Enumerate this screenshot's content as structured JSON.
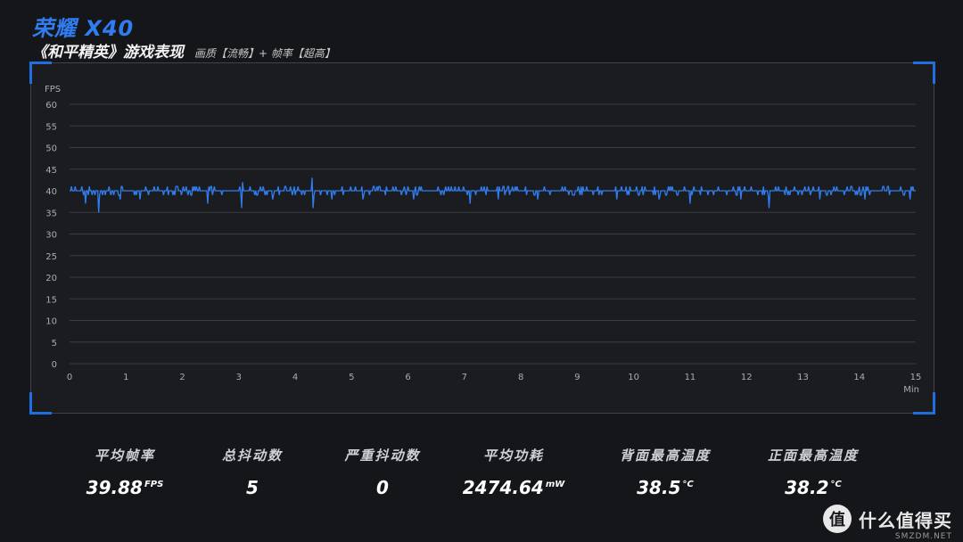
{
  "header": {
    "brand": "荣耀 X40",
    "game_title": "《和平精英》游戏表现",
    "settings": "画质【流畅】+ 帧率【超高】"
  },
  "chart_data": {
    "type": "line",
    "ylabel": "FPS",
    "xlabel": "Min",
    "ylim": [
      0,
      60
    ],
    "xlim": [
      0,
      15
    ],
    "y_ticks": [
      0,
      5,
      10,
      15,
      20,
      25,
      30,
      35,
      40,
      45,
      50,
      55,
      60
    ],
    "x_ticks": [
      0,
      1,
      2,
      3,
      4,
      5,
      6,
      7,
      8,
      9,
      10,
      11,
      12,
      13,
      14,
      15
    ],
    "grid": true,
    "line_color": "#2f7df0",
    "baseline": 40,
    "dips": [
      {
        "x": 0.28,
        "y": 37
      },
      {
        "x": 0.52,
        "y": 35
      },
      {
        "x": 0.9,
        "y": 38
      },
      {
        "x": 1.25,
        "y": 38
      },
      {
        "x": 2.45,
        "y": 37
      },
      {
        "x": 3.05,
        "y": 36
      },
      {
        "x": 3.6,
        "y": 38
      },
      {
        "x": 4.32,
        "y": 36
      },
      {
        "x": 4.65,
        "y": 38
      },
      {
        "x": 5.2,
        "y": 38
      },
      {
        "x": 6.1,
        "y": 38
      },
      {
        "x": 7.1,
        "y": 37
      },
      {
        "x": 7.6,
        "y": 38
      },
      {
        "x": 8.3,
        "y": 38
      },
      {
        "x": 9.7,
        "y": 38
      },
      {
        "x": 10.45,
        "y": 38
      },
      {
        "x": 11.0,
        "y": 37
      },
      {
        "x": 11.9,
        "y": 38
      },
      {
        "x": 12.4,
        "y": 36
      },
      {
        "x": 13.3,
        "y": 38
      },
      {
        "x": 14.1,
        "y": 38
      },
      {
        "x": 14.9,
        "y": 38
      }
    ],
    "peaks": [
      {
        "x": 3.07,
        "y": 42
      },
      {
        "x": 4.3,
        "y": 43
      },
      {
        "x": 11.2,
        "y": 41
      },
      {
        "x": 13.6,
        "y": 41
      }
    ]
  },
  "stats": [
    {
      "label": "平均帧率",
      "value": "39.88",
      "unit": "FPS"
    },
    {
      "label": "总抖动数",
      "value": "5",
      "unit": ""
    },
    {
      "label": "严重抖动数",
      "value": "0",
      "unit": ""
    },
    {
      "label": "平均功耗",
      "value": "2474.64",
      "unit": "mW"
    },
    {
      "label": "背面最高温度",
      "value": "38.5",
      "unit": "°C"
    },
    {
      "label": "正面最高温度",
      "value": "38.2",
      "unit": "°C"
    }
  ],
  "watermark": {
    "logo_glyph": "值",
    "text": "什么值得买",
    "sub": "SMZDM.NET"
  }
}
